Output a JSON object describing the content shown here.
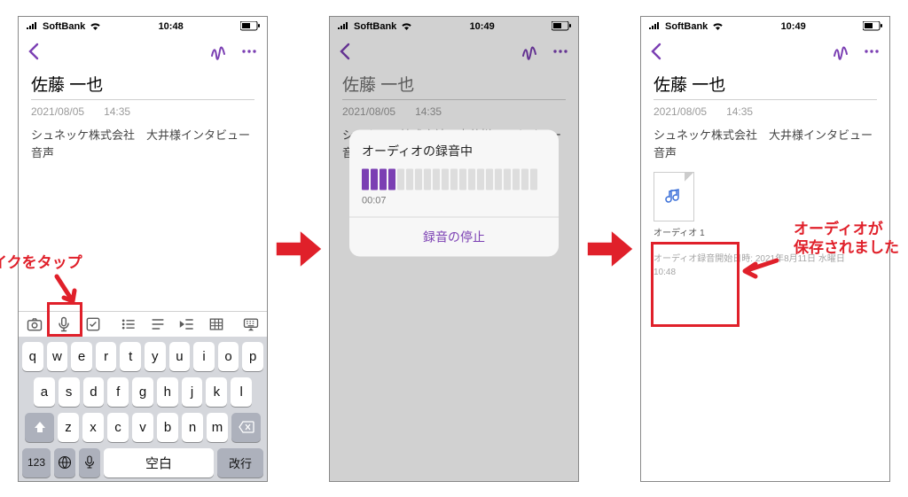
{
  "status": {
    "carrier": "SoftBank",
    "time1": "10:48",
    "time2": "10:49",
    "time3": "10:49"
  },
  "note": {
    "title": "佐藤 一也",
    "date": "2021/08/05",
    "time": "14:35",
    "body": "シュネッケ株式会社　大井様インタビュー音声"
  },
  "keyboard": {
    "row1": [
      "q",
      "w",
      "e",
      "r",
      "t",
      "y",
      "u",
      "i",
      "o",
      "p"
    ],
    "row2": [
      "a",
      "s",
      "d",
      "f",
      "g",
      "h",
      "j",
      "k",
      "l"
    ],
    "row3": [
      "z",
      "x",
      "c",
      "v",
      "b",
      "n",
      "m"
    ],
    "nums": "123",
    "space": "空白",
    "return": "改行"
  },
  "modal": {
    "title": "オーディオの録音中",
    "elapsed": "00:07",
    "stop": "録音の停止",
    "active_bars": 4,
    "total_bars": 20
  },
  "audio": {
    "label": "オーディオ 1"
  },
  "stamp": {
    "line1": "オーディオ録音開始日時: 2021年8月11日 水曜日",
    "line2": "10:48"
  },
  "callouts": {
    "tap_mic": "マイクをタップ",
    "saved_l1": "オーディオが",
    "saved_l2": "保存されました"
  },
  "icons": {
    "back": "back-chevron",
    "squiggle": "scribble-icon",
    "more": "more-icon",
    "camera": "camera-icon",
    "mic": "mic-icon",
    "check": "checkbox-icon",
    "list": "bullet-list-icon",
    "h": "heading-icon",
    "indent": "indent-icon",
    "table": "table-icon",
    "kbd": "keyboard-toggle-icon",
    "shift": "shift-icon",
    "del": "delete-icon",
    "globe": "globe-icon",
    "note": "audio-note-icon"
  }
}
